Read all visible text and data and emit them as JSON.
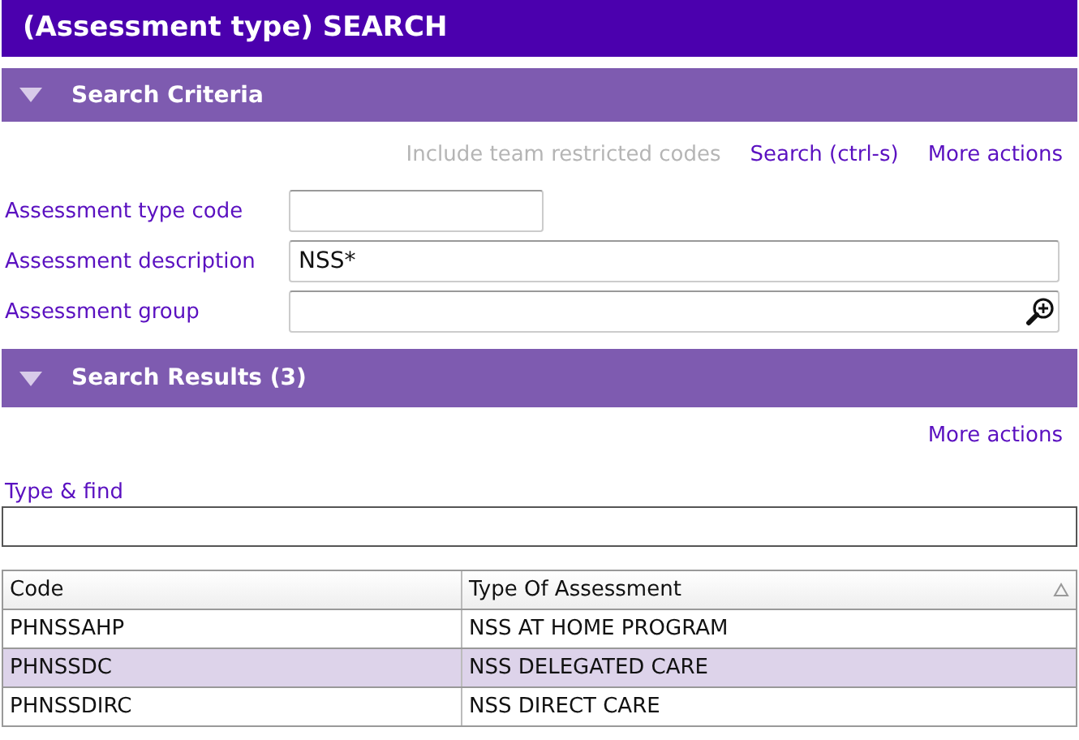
{
  "window": {
    "title": "(Assessment type) SEARCH"
  },
  "criteria": {
    "label": "Search Criteria",
    "expanded": true,
    "actions": [
      {
        "label": "Include team restricted codes",
        "disabled": true
      },
      {
        "label": "Search (ctrl-s)",
        "disabled": false
      },
      {
        "label": "More actions",
        "disabled": false
      }
    ],
    "fields": [
      {
        "label": "Assessment type code",
        "kind": "short"
      },
      {
        "label": "Assessment description",
        "kind": "text",
        "value": "NSS*"
      },
      {
        "label": "Assessment group",
        "kind": "lookup"
      }
    ]
  },
  "results": {
    "label": "Search Results (3)",
    "expanded": true,
    "actions": [
      {
        "label": "More actions",
        "disabled": false
      }
    ],
    "find": {
      "label": "Type & find"
    },
    "table": {
      "columns": [
        {
          "label": "Code",
          "sorted": false
        },
        {
          "label": "Type Of Assessment",
          "sorted": true
        }
      ],
      "rows": [
        {
          "cells": [
            "PHNSSAHP",
            "NSS AT HOME PROGRAM"
          ],
          "selected": false
        },
        {
          "cells": [
            "PHNSSDC",
            "NSS DELEGATED CARE"
          ],
          "selected": true
        },
        {
          "cells": [
            "PHNSSDIRC",
            "NSS DIRECT CARE"
          ],
          "selected": false
        }
      ]
    }
  }
}
